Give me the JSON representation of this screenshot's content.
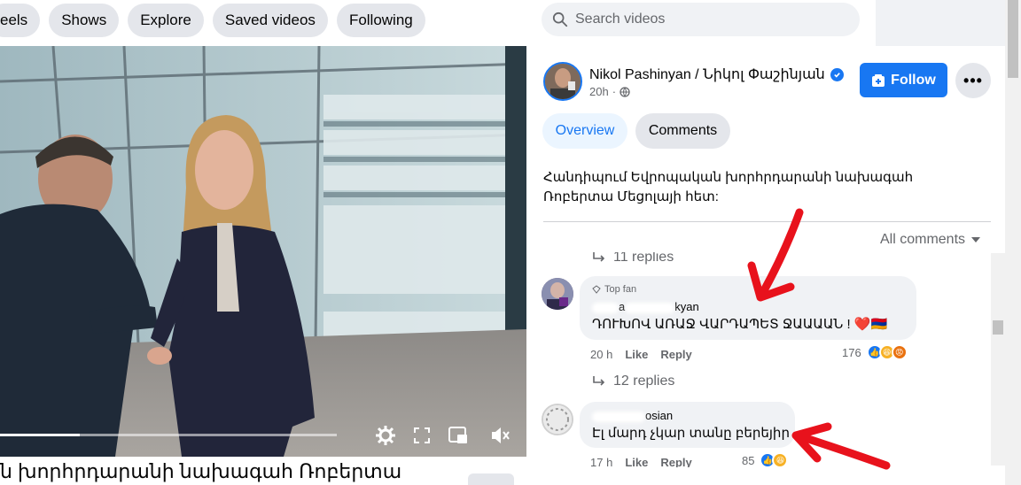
{
  "nav": {
    "items": [
      "eels",
      "Shows",
      "Explore",
      "Saved videos",
      "Following"
    ]
  },
  "search": {
    "placeholder": "Search videos"
  },
  "post": {
    "author": "Nikol Pashinyan / Նիկոլ Փաշինյան",
    "time": "20h",
    "follow_label": "Follow",
    "more_label": "•••",
    "tabs": [
      "Overview",
      "Comments"
    ],
    "description": "Հանդիպում Եվրոպական խորհրդարանի նախագահ Ռոբերտա Մեցոլայի հետ:",
    "all_comments_label": "All comments",
    "video_caption": "ն խորհրդարանի նախագահ Ռոբերտա"
  },
  "comments": [
    {
      "replies_above": "11 replies",
      "badge": "Top fan",
      "name_fragment_1": "a",
      "name_fragment_2": "kyan",
      "text": "ԴՈՒԽՈՎ ԱՌԱՋ ՎԱՐԴԱՊԵՏ ՋԱԱԱԱՆ ! ❤️🇦🇲",
      "time": "20 h",
      "like_label": "Like",
      "reply_label": "Reply",
      "reaction_count": "176",
      "replies_below": "12 replies"
    },
    {
      "name_fragment_1": "osian",
      "text": "Էլ մարդ չկար տանը բերեյիր",
      "time": "17 h",
      "like_label": "Like",
      "reply_label": "Reply",
      "reaction_count": "85"
    }
  ],
  "colors": {
    "brand": "#1877f2",
    "annotation_arrow": "#e8121c"
  },
  "icons": [
    "search-icon",
    "verified-badge-icon",
    "globe-icon",
    "follow-plus-icon",
    "more-dots-icon",
    "dropdown-caret-icon",
    "reply-arrow-icon",
    "gear-icon",
    "fullscreen-icon",
    "pip-icon",
    "volume-muted-icon"
  ]
}
